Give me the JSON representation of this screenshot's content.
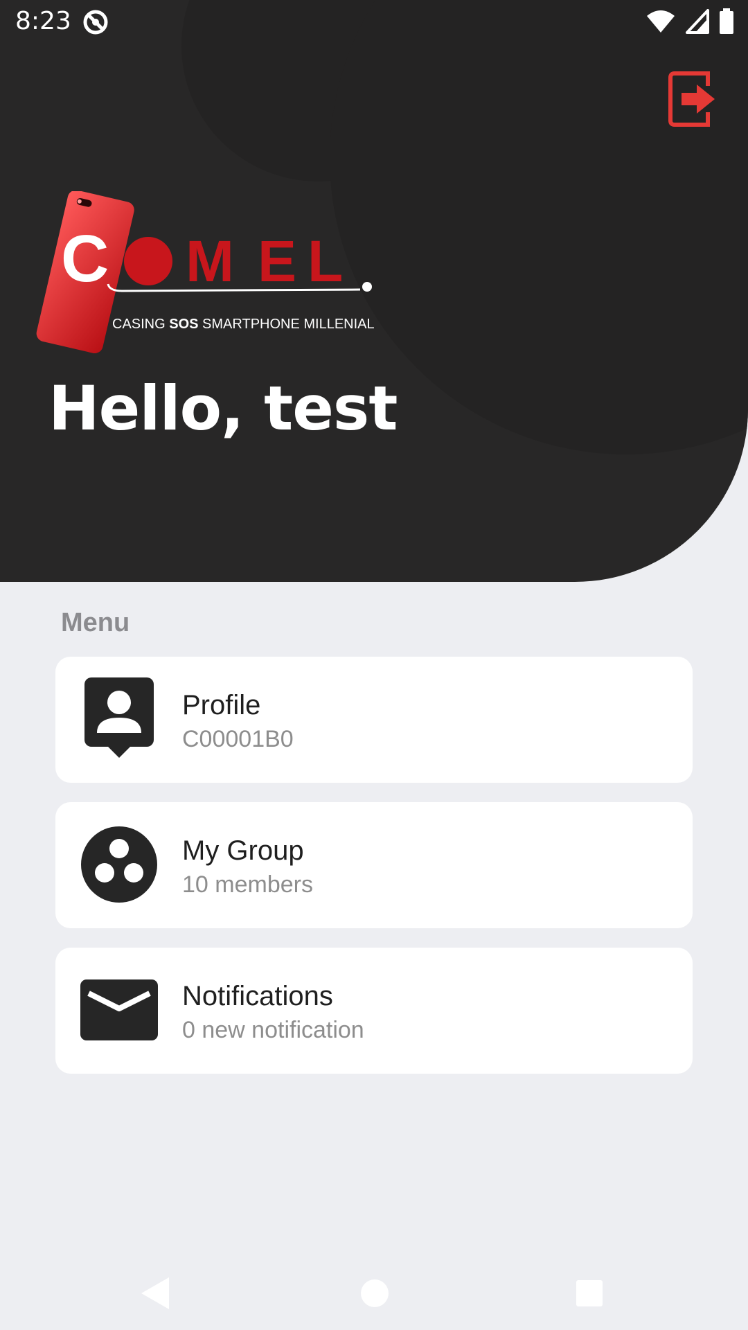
{
  "status_bar": {
    "time": "8:23"
  },
  "header": {
    "logo": {
      "letters": [
        "C",
        "M",
        "E",
        "L"
      ],
      "tagline_prefix": "CASING ",
      "tagline_bold": "SOS",
      "tagline_suffix": " SMARTPHONE MILLENIAL"
    },
    "greeting": "Hello, test"
  },
  "menu": {
    "heading": "Menu",
    "items": [
      {
        "title": "Profile",
        "subtitle": "C00001B0",
        "icon": "profile-icon"
      },
      {
        "title": "My Group",
        "subtitle": "10 members",
        "icon": "group-icon"
      },
      {
        "title": "Notifications",
        "subtitle": "0 new notification",
        "icon": "mail-icon"
      }
    ]
  },
  "colors": {
    "header_bg": "#282727",
    "accent_red": "#e53935",
    "page_bg": "#edeef2",
    "card_bg": "#ffffff",
    "icon_dark": "#262626"
  }
}
